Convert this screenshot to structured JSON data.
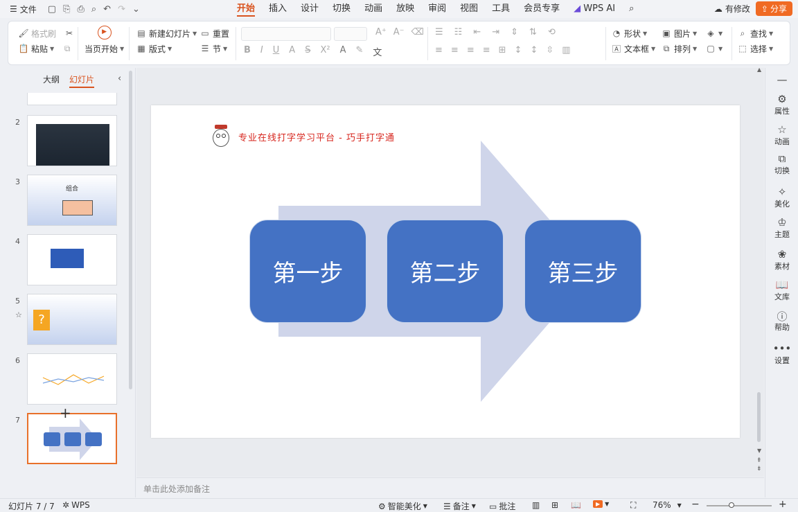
{
  "menubar": {
    "file_label": "文件",
    "tabs": [
      "开始",
      "插入",
      "设计",
      "切换",
      "动画",
      "放映",
      "审阅",
      "视图",
      "工具",
      "会员专享"
    ],
    "active_tab": "开始",
    "wps_ai": "WPS AI",
    "modify_label": "有修改",
    "share_label": "分享"
  },
  "ribbon": {
    "format_painter": "格式刷",
    "paste": "粘贴",
    "play_from_start": "当页开始",
    "new_slide": "新建幻灯片",
    "reset": "重置",
    "layout": "版式",
    "section": "节",
    "shape": "形状",
    "picture": "图片",
    "textbox": "文本框",
    "arrange": "排列",
    "find": "查找",
    "select": "选择"
  },
  "left_panel": {
    "tab_outline": "大纲",
    "tab_slides": "幻灯片",
    "slides": [
      {
        "num": "2"
      },
      {
        "num": "3",
        "title": "组合"
      },
      {
        "num": "4"
      },
      {
        "num": "5"
      },
      {
        "num": "6"
      },
      {
        "num": "7"
      }
    ]
  },
  "slide": {
    "brand_text": "专业在线打字学习平台 - 巧手打字通",
    "steps": [
      "第一步",
      "第二步",
      "第三步"
    ],
    "colors": {
      "step": "#4472c4",
      "arrow": "#cfd5ea",
      "brand": "#d7261e"
    }
  },
  "notes_placeholder": "单击此处添加备注",
  "right_sidebar": [
    "属性",
    "动画",
    "切换",
    "美化",
    "主题",
    "素材",
    "文库",
    "帮助",
    "设置"
  ],
  "statusbar": {
    "slide_count": "幻灯片 7 / 7",
    "wps": "WPS",
    "smart_beautify": "智能美化",
    "notes": "备注",
    "comments": "批注",
    "zoom": "76%"
  }
}
